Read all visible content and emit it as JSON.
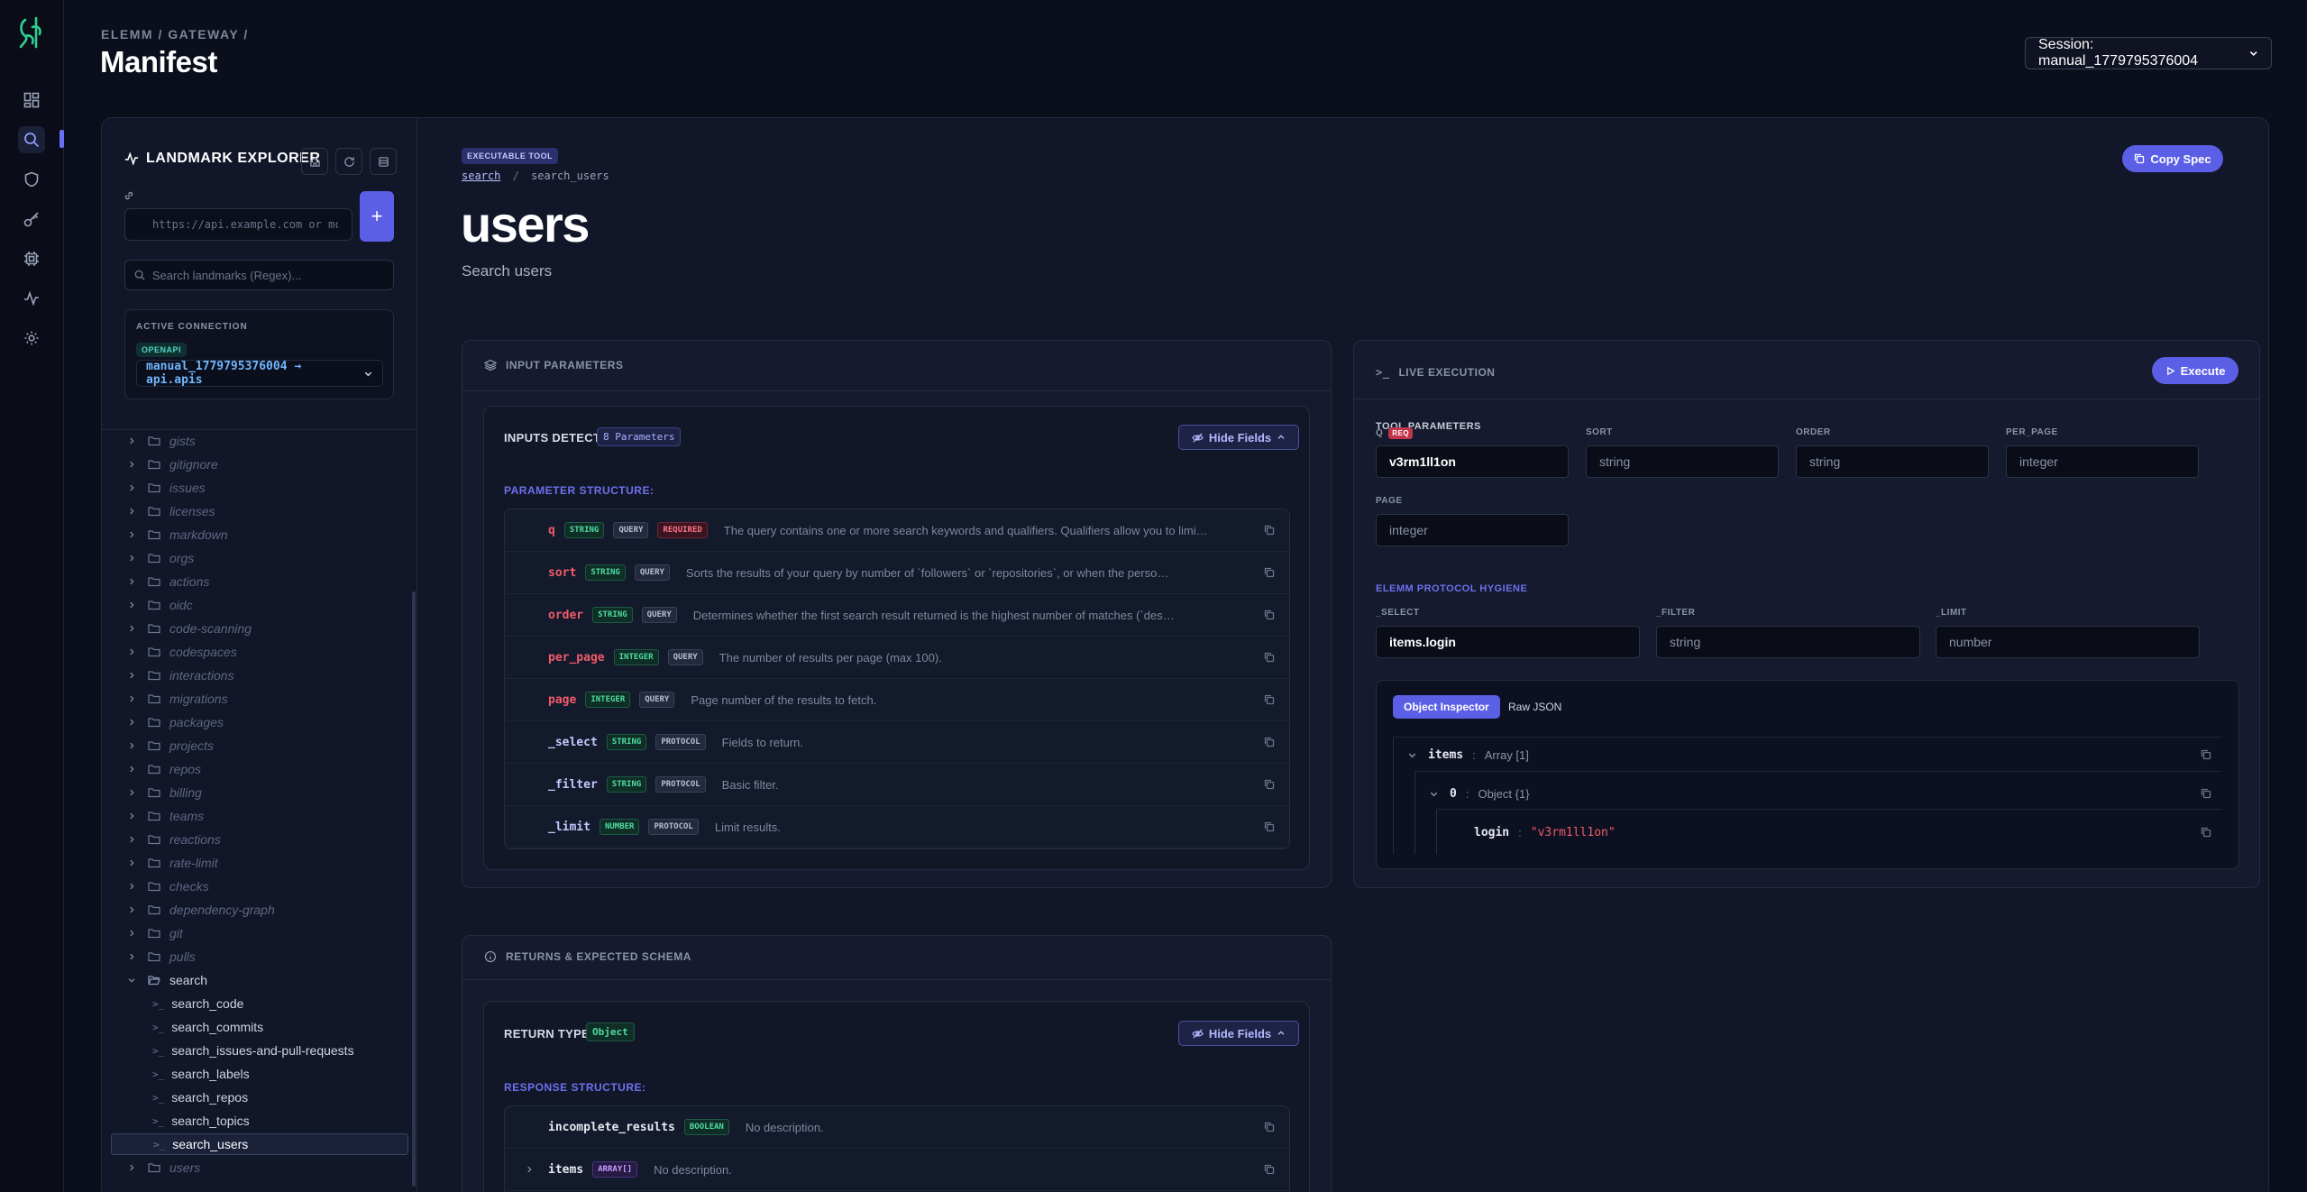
{
  "header": {
    "breadcrumb": "ELEMM / GATEWAY /",
    "title": "Manifest",
    "session_label": "Session: manual_1779795376004"
  },
  "explorer": {
    "title": "LANDMARK EXPLORER",
    "url_placeholder": "https://api.example.com or mcp:...",
    "add_label": "+",
    "search_placeholder": "Search landmarks (Regex)...",
    "connection_label": "ACTIVE CONNECTION",
    "connection_type": "OPENAPI",
    "connection_value": "manual_1779795376004 → api.apis",
    "folders": [
      "gists",
      "gitignore",
      "issues",
      "licenses",
      "markdown",
      "orgs",
      "actions",
      "oidc",
      "code-scanning",
      "codespaces",
      "interactions",
      "migrations",
      "packages",
      "projects",
      "repos",
      "billing",
      "teams",
      "reactions",
      "rate-limit",
      "checks",
      "dependency-graph",
      "git",
      "pulls"
    ],
    "open_folder": "search",
    "children": [
      "search_code",
      "search_commits",
      "search_issues-and-pull-requests",
      "search_labels",
      "search_repos",
      "search_topics",
      "search_users"
    ],
    "selected": "search_users",
    "after_folder": "users"
  },
  "tool": {
    "badge": "EXECUTABLE TOOL",
    "crumb_link": "search",
    "crumb_sep": "/",
    "crumb_current": "search_users",
    "name": "users",
    "description": "Search users",
    "copy_label": "Copy Spec"
  },
  "inputs": {
    "panel_title": "INPUT PARAMETERS",
    "detected_label": "INPUTS DETECTED:",
    "count_label": "8 Parameters",
    "hide_label": "Hide Fields",
    "structure_label": "PARAMETER STRUCTURE:",
    "params": [
      {
        "name": "q",
        "type": "STRING",
        "loc": "QUERY",
        "required": "REQUIRED",
        "style": "red",
        "desc": "The query contains one or more search keywords and qualifiers. Qualifiers allow you to limit y..."
      },
      {
        "name": "sort",
        "type": "STRING",
        "loc": "QUERY",
        "style": "red",
        "desc": "Sorts the results of your query by number of `followers` or `repositories`, or when the person `joined`. G..."
      },
      {
        "name": "order",
        "type": "STRING",
        "loc": "QUERY",
        "style": "red",
        "desc": "Determines whether the first search result returned is the highest number of matches (`desc`) or lowe..."
      },
      {
        "name": "per_page",
        "type": "INTEGER",
        "loc": "QUERY",
        "style": "red",
        "desc": "The number of results per page (max 100)."
      },
      {
        "name": "page",
        "type": "INTEGER",
        "loc": "QUERY",
        "style": "red",
        "desc": "Page number of the results to fetch."
      },
      {
        "name": "_select",
        "type": "STRING",
        "loc": "PROTOCOL",
        "style": "blue",
        "desc": "Fields to return."
      },
      {
        "name": "_filter",
        "type": "STRING",
        "loc": "PROTOCOL",
        "style": "blue",
        "desc": "Basic filter."
      },
      {
        "name": "_limit",
        "type": "NUMBER",
        "loc": "PROTOCOL",
        "style": "blue",
        "desc": "Limit results."
      }
    ]
  },
  "execution": {
    "panel_title": "LIVE EXECUTION",
    "execute_label": "Execute",
    "tool_params_label": "TOOL PARAMETERS",
    "fields": [
      {
        "label": "Q",
        "req": "REQ",
        "value": "v3rm1ll1on",
        "placeholder": ""
      },
      {
        "label": "SORT",
        "value": "",
        "placeholder": "string"
      },
      {
        "label": "ORDER",
        "value": "",
        "placeholder": "string"
      },
      {
        "label": "PER_PAGE",
        "value": "",
        "placeholder": "integer"
      },
      {
        "label": "PAGE",
        "value": "",
        "placeholder": "integer"
      }
    ],
    "hygiene_label": "ELEMM PROTOCOL HYGIENE",
    "hygiene_fields": [
      {
        "label": "_SELECT",
        "value": "items.login",
        "placeholder": ""
      },
      {
        "label": "_FILTER",
        "value": "",
        "placeholder": "string"
      },
      {
        "label": "_LIMIT",
        "value": "",
        "placeholder": "number"
      }
    ],
    "tab_inspector": "Object Inspector",
    "tab_raw": "Raw JSON",
    "result": {
      "items_key": "items",
      "items_type": "Array [1]",
      "index_key": "0",
      "index_type": "Object {1}",
      "login_key": "login",
      "login_value": "\"v3rm1ll1on\"",
      "separator": ":"
    }
  },
  "returns": {
    "panel_title": "RETURNS & EXPECTED SCHEMA",
    "type_label": "RETURN TYPE:",
    "type_value": "Object",
    "hide_label": "Hide Fields",
    "structure_label": "RESPONSE STRUCTURE:",
    "fields": [
      {
        "name": "incomplete_results",
        "type": "BOOLEAN",
        "desc": "No description."
      },
      {
        "name": "items",
        "type": "ARRAY[]",
        "desc": "No description."
      }
    ]
  }
}
